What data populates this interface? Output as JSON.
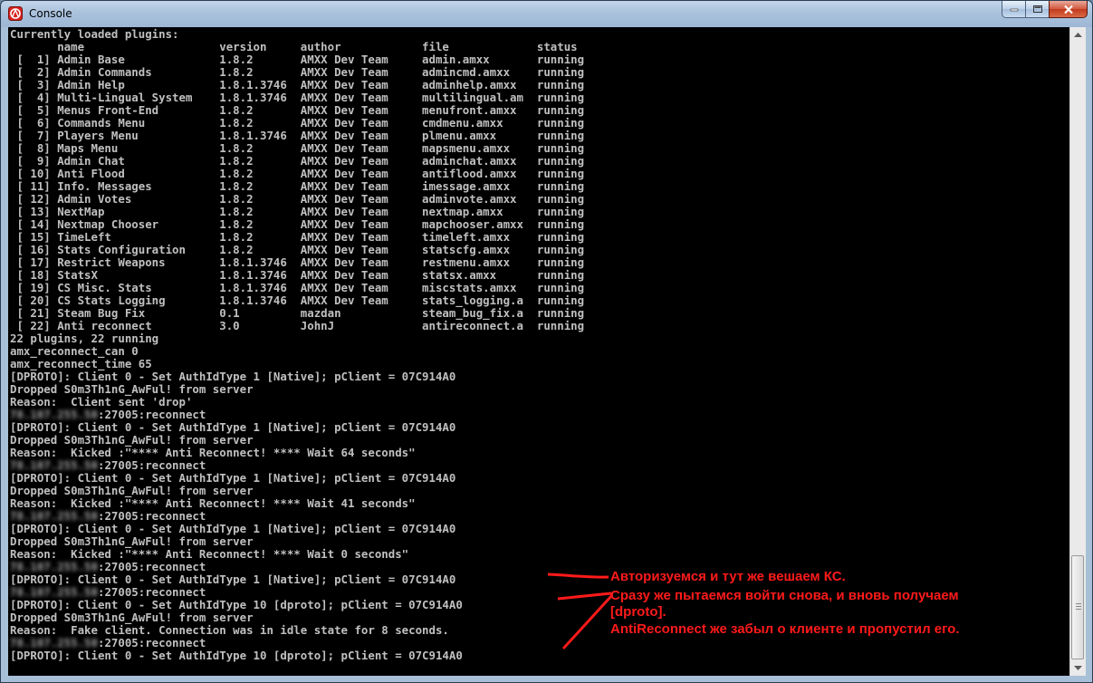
{
  "window": {
    "title": "Console"
  },
  "colors": {
    "console_bg": "#000000",
    "console_text": "#c0c0c0",
    "annotation": "#ff1a1a"
  },
  "console": {
    "lines": [
      "Currently loaded plugins:",
      "       name                    version     author            file             status",
      " [  1] Admin Base              1.8.2       AMXX Dev Team     admin.amxx       running",
      " [  2] Admin Commands          1.8.2       AMXX Dev Team     admincmd.amxx    running",
      " [  3] Admin Help              1.8.1.3746  AMXX Dev Team     adminhelp.amxx   running",
      " [  4] Multi-Lingual System    1.8.1.3746  AMXX Dev Team     multilingual.am  running",
      " [  5] Menus Front-End         1.8.2       AMXX Dev Team     menufront.amxx   running",
      " [  6] Commands Menu           1.8.2       AMXX Dev Team     cmdmenu.amxx     running",
      " [  7] Players Menu            1.8.1.3746  AMXX Dev Team     plmenu.amxx      running",
      " [  8] Maps Menu               1.8.2       AMXX Dev Team     mapsmenu.amxx    running",
      " [  9] Admin Chat              1.8.2       AMXX Dev Team     adminchat.amxx   running",
      " [ 10] Anti Flood              1.8.2       AMXX Dev Team     antiflood.amxx   running",
      " [ 11] Info. Messages          1.8.2       AMXX Dev Team     imessage.amxx    running",
      " [ 12] Admin Votes             1.8.2       AMXX Dev Team     adminvote.amxx   running",
      " [ 13] NextMap                 1.8.2       AMXX Dev Team     nextmap.amxx     running",
      " [ 14] Nextmap Chooser         1.8.2       AMXX Dev Team     mapchooser.amxx  running",
      " [ 15] TimeLeft                1.8.2       AMXX Dev Team     timeleft.amxx    running",
      " [ 16] Stats Configuration     1.8.2       AMXX Dev Team     statscfg.amxx    running",
      " [ 17] Restrict Weapons        1.8.1.3746  AMXX Dev Team     restmenu.amxx    running",
      " [ 18] StatsX                  1.8.1.3746  AMXX Dev Team     statsx.amxx      running",
      " [ 19] CS Misc. Stats          1.8.1.3746  AMXX Dev Team     miscstats.amxx   running",
      " [ 20] CS Stats Logging        1.8.1.3746  AMXX Dev Team     stats_logging.a  running",
      " [ 21] Steam Bug Fix           0.1         mazdan            steam_bug_fix.a  running",
      " [ 22] Anti reconnect          3.0         JohnJ             antireconnect.a  running",
      "22 plugins, 22 running",
      "amx_reconnect_can 0",
      "amx_reconnect_time 65",
      "[DPROTO]: Client 0 - Set AuthIdType 1 [Native]; pClient = 07C914A0",
      "Dropped S0m3Th1nG_AwFul! from server",
      "Reason:  Client sent 'drop'",
      "#BLUR#:27005:reconnect",
      "[DPROTO]: Client 0 - Set AuthIdType 1 [Native]; pClient = 07C914A0",
      "Dropped S0m3Th1nG_AwFul! from server",
      "Reason:  Kicked :\"**** Anti Reconnect! **** Wait 64 seconds\"",
      "#BLUR#:27005:reconnect",
      "[DPROTO]: Client 0 - Set AuthIdType 1 [Native]; pClient = 07C914A0",
      "Dropped S0m3Th1nG_AwFul! from server",
      "Reason:  Kicked :\"**** Anti Reconnect! **** Wait 41 seconds\"",
      "#BLUR#:27005:reconnect",
      "[DPROTO]: Client 0 - Set AuthIdType 1 [Native]; pClient = 07C914A0",
      "Dropped S0m3Th1nG_AwFul! from server",
      "Reason:  Kicked :\"**** Anti Reconnect! **** Wait 0 seconds\"",
      "#BLUR#:27005:reconnect",
      "[DPROTO]: Client 0 - Set AuthIdType 1 [Native]; pClient = 07C914A0",
      "#BLUR#:27005:reconnect",
      "[DPROTO]: Client 0 - Set AuthIdType 10 [dproto]; pClient = 07C914A0",
      "Dropped S0m3Th1nG_AwFul! from server",
      "Reason:  Fake client. Connection was in idle state for 8 seconds.",
      "#BLUR#:27005:reconnect",
      "[DPROTO]: Client 0 - Set AuthIdType 10 [dproto]; pClient = 07C914A0"
    ],
    "blurred_ip": "78.107.255.50"
  },
  "annotations": {
    "note1": "Авторизуемся и тут же вешаем КС.",
    "note2_line1": "Сразу же пытаемся войти снова, и вновь получаем",
    "note2_line2": "[dproto].",
    "note2_line3": "AntiReconnect же забыл о клиенте и пропустил его."
  }
}
